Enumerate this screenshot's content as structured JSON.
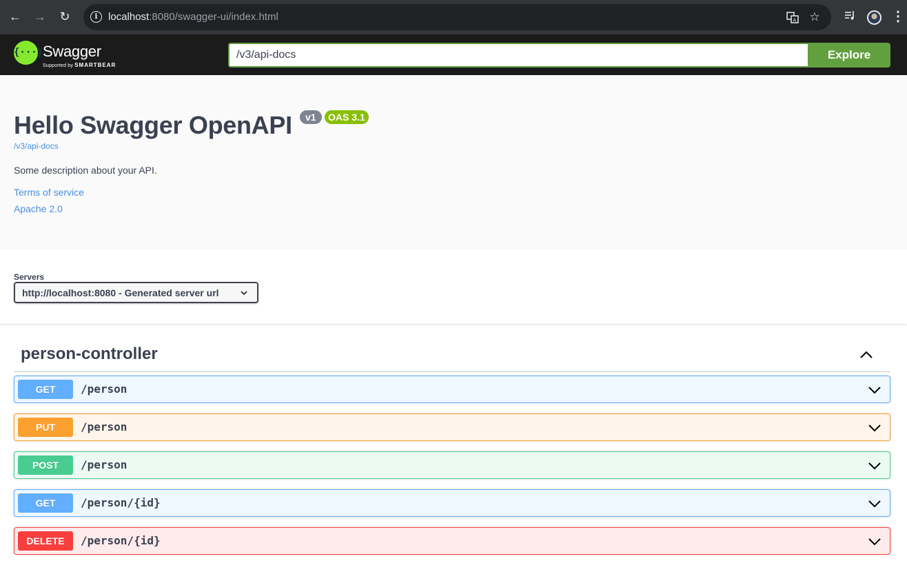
{
  "browser": {
    "url_host": "localhost",
    "url_rest": ":8080/swagger-ui/index.html"
  },
  "topbar": {
    "logo_text": "Swagger",
    "logo_sub_prefix": "Supported by",
    "logo_sub_brand": "SMARTBEAR",
    "spec_url_value": "/v3/api-docs",
    "explore_label": "Explore"
  },
  "info": {
    "title": "Hello Swagger OpenAPI",
    "version_badge": "v1",
    "oas_badge": "OAS 3.1",
    "spec_link": "/v3/api-docs",
    "description": "Some description about your API.",
    "terms_link": "Terms of service",
    "license_link": "Apache 2.0"
  },
  "servers": {
    "label": "Servers",
    "selected": "http://localhost:8080 - Generated server url"
  },
  "tag": {
    "name": "person-controller",
    "operations": [
      {
        "method": "GET",
        "path": "/person"
      },
      {
        "method": "PUT",
        "path": "/person"
      },
      {
        "method": "POST",
        "path": "/person"
      },
      {
        "method": "GET",
        "path": "/person/{id}"
      },
      {
        "method": "DELETE",
        "path": "/person/{id}"
      }
    ]
  },
  "colors": {
    "get": "#61affe",
    "put": "#fca130",
    "post": "#49cc90",
    "delete": "#f93e3e",
    "explore": "#62a03f",
    "logo": "#85ea2d"
  }
}
